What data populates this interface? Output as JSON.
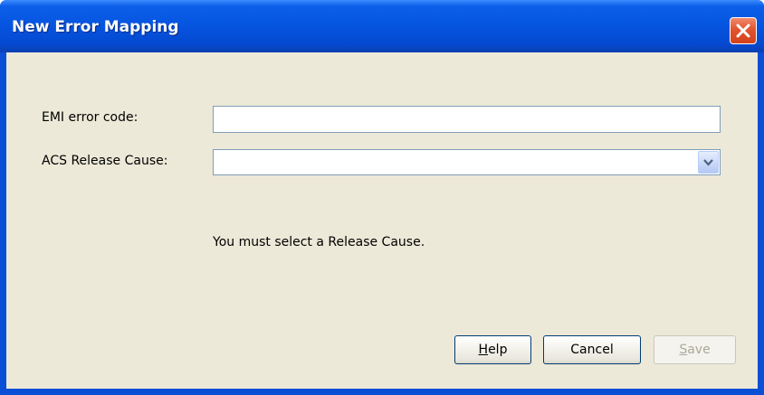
{
  "window": {
    "title": "New Error Mapping",
    "close_icon": "close-icon"
  },
  "form": {
    "emi_label": "EMI error code:",
    "emi_value": "",
    "release_cause_label": "ACS Release Cause:",
    "release_cause_value": "",
    "dropdown_icon": "chevron-down-icon"
  },
  "validation": {
    "message": "You must select a Release Cause."
  },
  "buttons": {
    "help_mnemonic": "H",
    "help_rest": "elp",
    "cancel": "Cancel",
    "save_mnemonic": "S",
    "save_rest": "ave",
    "save_enabled": false
  },
  "colors": {
    "titlebar": "#0654e0",
    "client_background": "#ece9d8",
    "close_button": "#e2542e",
    "input_border": "#7f9db9",
    "disabled_text": "#aca899"
  }
}
